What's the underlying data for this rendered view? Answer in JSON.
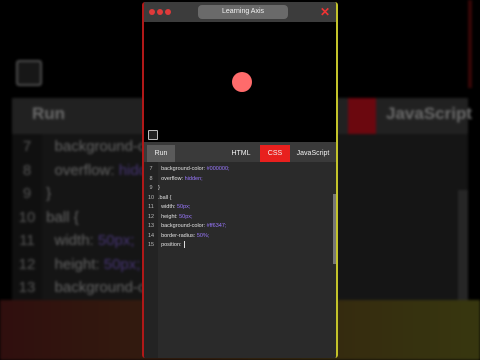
{
  "window": {
    "title": "Learning Axis"
  },
  "tabs": {
    "run": "Run",
    "html": "HTML",
    "css": "CSS",
    "javascript": "JavaScript"
  },
  "preview": {
    "ball_color": "#ff6b6b",
    "background": "#000000"
  },
  "code_lines": [
    {
      "num": "7",
      "prop": "background-color: ",
      "val": "#000000;"
    },
    {
      "num": "8",
      "prop": "overflow: ",
      "val": "hidden;"
    },
    {
      "num": "9",
      "prop": "}",
      "val": ""
    },
    {
      "num": "10",
      "prop": ".ball {",
      "val": ""
    },
    {
      "num": "11",
      "prop": "width: ",
      "val": "50px;"
    },
    {
      "num": "12",
      "prop": "height: ",
      "val": "50px;"
    },
    {
      "num": "13",
      "prop": "background-color: ",
      "val": "#ff6347;"
    },
    {
      "num": "14",
      "prop": "border-radius: ",
      "val": "50%;"
    },
    {
      "num": "15",
      "prop": "position: ",
      "val": ""
    }
  ],
  "bg_code_lines": [
    {
      "num": "7",
      "prop": "background-co",
      "val": ""
    },
    {
      "num": "8",
      "prop": "overflow: ",
      "val": "hidde"
    },
    {
      "num": "9",
      "prop": "}",
      "val": ""
    },
    {
      "num": "10",
      "prop": "ball {",
      "val": ""
    },
    {
      "num": "11",
      "prop": "width: ",
      "val": "50px;"
    },
    {
      "num": "12",
      "prop": "height: ",
      "val": "50px;"
    },
    {
      "num": "13",
      "prop": "background-co",
      "val": ""
    },
    {
      "num": "14",
      "prop": "border-radius: ",
      "val": ""
    },
    {
      "num": "15",
      "prop": "position: ",
      "val": ""
    }
  ],
  "colors": {
    "accent": "#e8201e",
    "title_dot": "#e03a3a",
    "code_value": "#9a78ff"
  }
}
